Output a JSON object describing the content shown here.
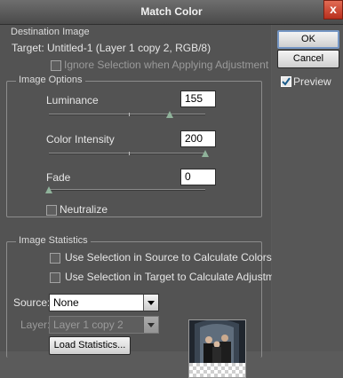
{
  "window": {
    "title": "Match Color",
    "close_glyph": "x"
  },
  "destination": {
    "legend": "Destination Image",
    "target_text": "Target:  Untitled-1 (Layer 1 copy 2, RGB/8)",
    "ignore_selection_label": "Ignore Selection when Applying Adjustment",
    "ignore_selection_checked": false
  },
  "image_options": {
    "legend": "Image Options",
    "luminance": {
      "label": "Luminance",
      "value": "155",
      "level": 0.77
    },
    "color_intensity": {
      "label": "Color Intensity",
      "value": "200",
      "level": 1.0
    },
    "fade": {
      "label": "Fade",
      "value": "0",
      "level": 0.0
    },
    "neutralize_label": "Neutralize",
    "neutralize_checked": false
  },
  "image_statistics": {
    "legend": "Image Statistics",
    "use_source_label": "Use Selection in Source to Calculate Colors",
    "use_target_label": "Use Selection in Target to Calculate Adjustment",
    "source_label": "Source:",
    "source_value": "None",
    "layer_label": "Layer:",
    "layer_value": "Layer 1 copy 2",
    "load_button": "Load Statistics..."
  },
  "buttons": {
    "ok": "OK",
    "cancel": "Cancel"
  },
  "preview": {
    "label": "Preview",
    "checked": true
  }
}
